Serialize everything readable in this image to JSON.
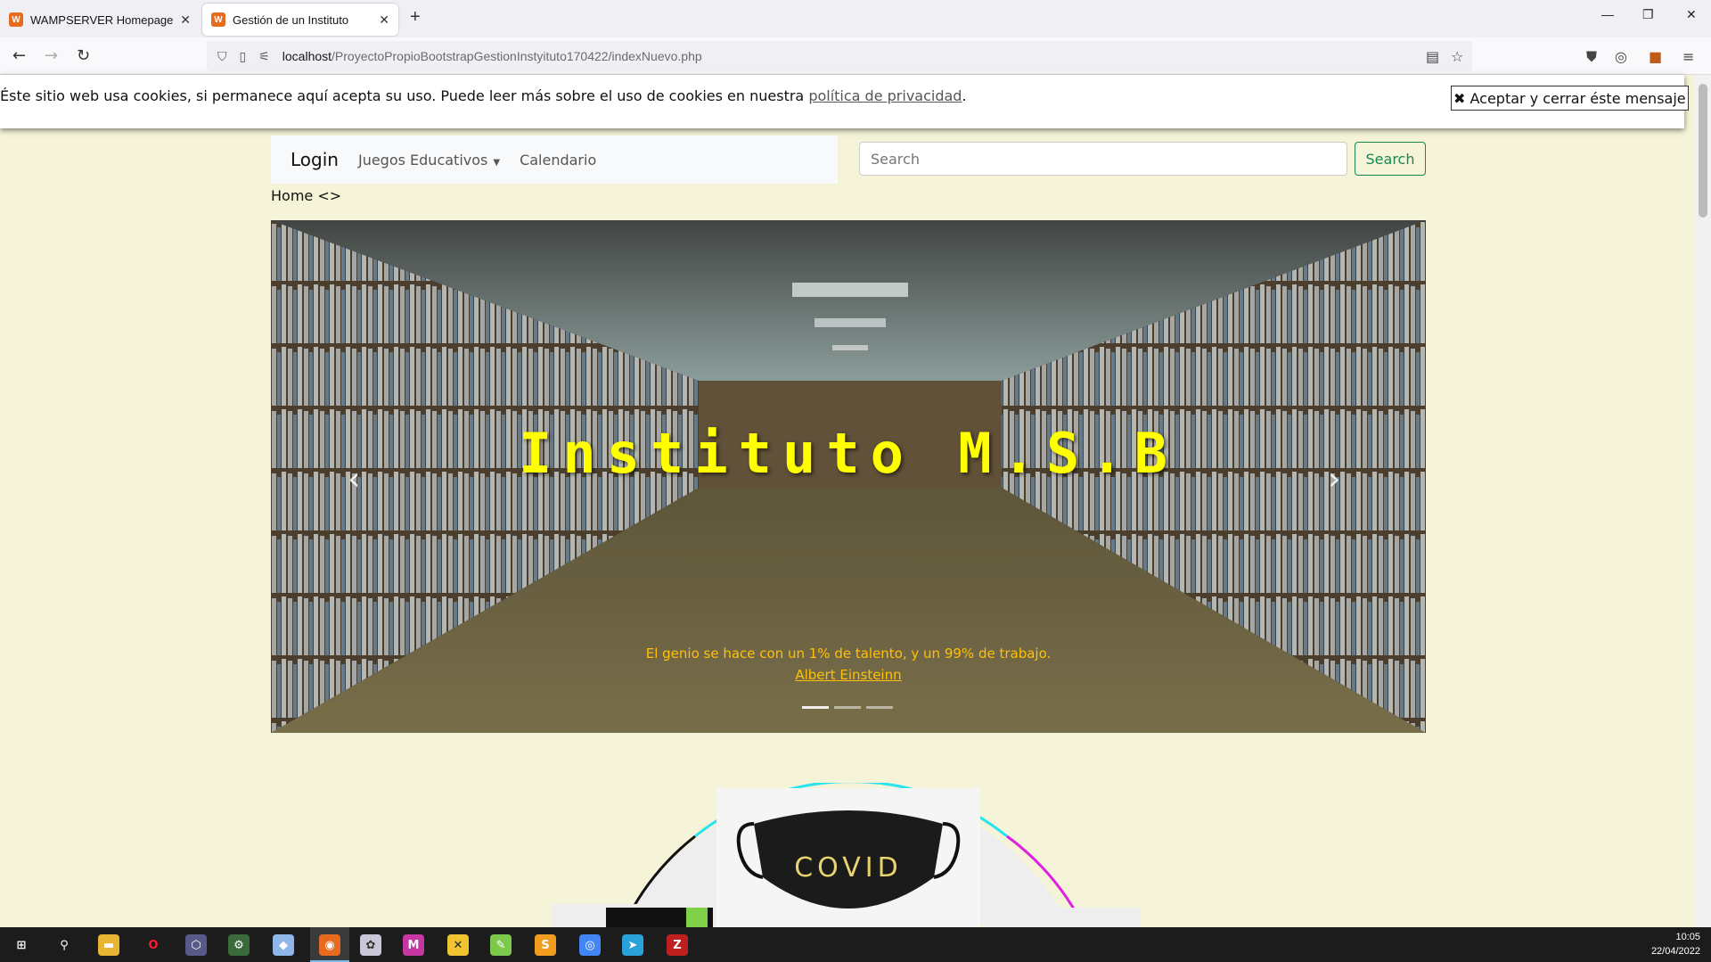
{
  "browser": {
    "tabs": [
      {
        "title": "WAMPSERVER Homepage",
        "active": false
      },
      {
        "title": "Gestión de un Instituto",
        "active": true
      }
    ],
    "url_host": "localhost",
    "url_path": "/ProyectoPropioBootstrapGestionInstyituto170422/indexNuevo.php"
  },
  "cookie_banner": {
    "text": "Éste sitio web usa cookies, si permanece aquí acepta su uso. Puede leer más sobre el uso de cookies en nuestra ",
    "link": "política de privacidad",
    "suffix": ".",
    "button": "✖ Aceptar y cerrar éste mensaje"
  },
  "navbar": {
    "brand": "Login",
    "links": [
      "Juegos Educativos",
      "Calendario"
    ],
    "search_placeholder": "Search",
    "search_button": "Search"
  },
  "breadcrumb": "Home <>",
  "carousel": {
    "title": "Instituto M.S.B",
    "quote": "El genio se hace con un 1% de talento, y un 99% de trabajo.",
    "author": "Albert Einsteinn",
    "slide_count": 3,
    "active_slide": 1
  },
  "cards": {
    "covid": "COVID"
  },
  "taskbar": {
    "time": "10:05",
    "date": "22/04/2022"
  },
  "colors": {
    "page_bg": "#f5f3d8",
    "title": "#ffff00",
    "quote": "#ffc107",
    "search_btn": "#198754"
  }
}
